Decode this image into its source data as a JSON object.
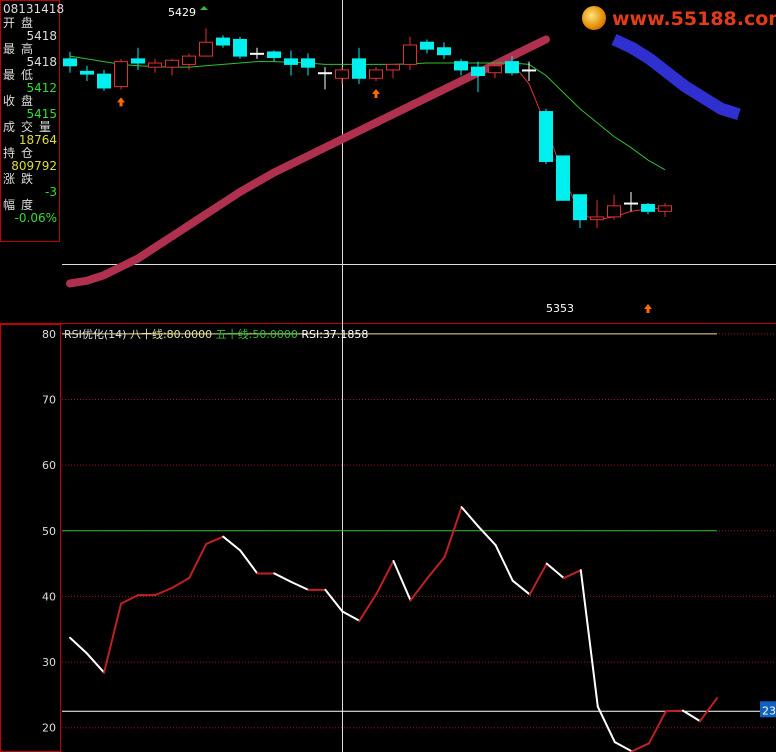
{
  "info_panel": {
    "time": "08131418",
    "rows": [
      {
        "label": "开盘",
        "value": "5418",
        "label_color": "#dddddd",
        "value_color": "#dddddd"
      },
      {
        "label": "最高",
        "value": "5418",
        "label_color": "#dddddd",
        "value_color": "#dddddd"
      },
      {
        "label": "最低",
        "value": "5412",
        "label_color": "#dddddd",
        "value_color": "#33dd33"
      },
      {
        "label": "收盘",
        "value": "5415",
        "label_color": "#dddddd",
        "value_color": "#33dd33"
      },
      {
        "label": "成交量",
        "value": "18764",
        "label_color": "#dddddd",
        "value_color": "#dddd33"
      },
      {
        "label": "持仓",
        "value": "809792",
        "label_color": "#dddddd",
        "value_color": "#dddd33"
      },
      {
        "label": "涨跌",
        "value": "-3",
        "label_color": "#dddddd",
        "value_color": "#33dd33"
      },
      {
        "label": "幅度",
        "value": "-0.06%",
        "label_color": "#dddddd",
        "value_color": "#33dd33"
      }
    ]
  },
  "watermark": {
    "text": "www.55188.com"
  },
  "colors": {
    "up": "#e03030",
    "down": "#00f0f0",
    "ma_green": "#30c030",
    "ma_red": "#e03030",
    "band_red": "#b03050",
    "band_blue": "#3030d0",
    "rsi_up": "#c02020",
    "rsi_down": "#ffffff",
    "line80": "#e0e0a0",
    "line50": "#30c030",
    "grid": "#a01818",
    "crosshair": "#dddddd"
  },
  "chart_data": [
    {
      "type": "candlestick",
      "annotations": [
        {
          "text": "5429",
          "kind": "high"
        },
        {
          "text": "5353",
          "kind": "low"
        }
      ],
      "candles": [
        {
          "o": 5414,
          "h": 5416.5,
          "l": 5409,
          "c": 5411.5
        },
        {
          "o": 5409.5,
          "h": 5411.5,
          "l": 5406,
          "c": 5408.5
        },
        {
          "o": 5408.5,
          "h": 5410,
          "l": 5402.5,
          "c": 5403.5
        },
        {
          "o": 5404,
          "h": 5414,
          "l": 5403,
          "c": 5413
        },
        {
          "o": 5414,
          "h": 5418,
          "l": 5410,
          "c": 5412.5
        },
        {
          "o": 5411,
          "h": 5414,
          "l": 5409,
          "c": 5412.5
        },
        {
          "o": 5411,
          "h": 5414,
          "l": 5408,
          "c": 5413.5
        },
        {
          "o": 5412,
          "h": 5416,
          "l": 5410,
          "c": 5415
        },
        {
          "o": 5415,
          "h": 5425,
          "l": 5415,
          "c": 5420
        },
        {
          "o": 5421.5,
          "h": 5422.5,
          "l": 5418,
          "c": 5419
        },
        {
          "o": 5421,
          "h": 5422,
          "l": 5414,
          "c": 5415
        },
        {
          "o": 5416,
          "h": 5418,
          "l": 5414,
          "c": 5416
        },
        {
          "o": 5416.5,
          "h": 5417,
          "l": 5413,
          "c": 5414.5
        },
        {
          "o": 5414,
          "h": 5417,
          "l": 5408,
          "c": 5412
        },
        {
          "o": 5414,
          "h": 5416,
          "l": 5408,
          "c": 5411
        },
        {
          "o": 5409,
          "h": 5411,
          "l": 5403,
          "c": 5409
        },
        {
          "o": 5407,
          "h": 5411,
          "l": 5405,
          "c": 5410
        },
        {
          "o": 5414,
          "h": 5418,
          "l": 5405,
          "c": 5407
        },
        {
          "o": 5407,
          "h": 5411,
          "l": 5406,
          "c": 5410
        },
        {
          "o": 5410,
          "h": 5412,
          "l": 5407,
          "c": 5412
        },
        {
          "o": 5412,
          "h": 5422,
          "l": 5410,
          "c": 5419
        },
        {
          "o": 5420,
          "h": 5421,
          "l": 5416,
          "c": 5417.5
        },
        {
          "o": 5418,
          "h": 5420,
          "l": 5414,
          "c": 5415.5
        },
        {
          "o": 5413,
          "h": 5414,
          "l": 5408,
          "c": 5410
        },
        {
          "o": 5411,
          "h": 5413,
          "l": 5402,
          "c": 5408
        },
        {
          "o": 5409,
          "h": 5413,
          "l": 5407,
          "c": 5411.5
        },
        {
          "o": 5413,
          "h": 5415,
          "l": 5408,
          "c": 5409
        },
        {
          "o": 5410,
          "h": 5413,
          "l": 5406,
          "c": 5410
        },
        {
          "o": 5395,
          "h": 5396,
          "l": 5376,
          "c": 5377
        },
        {
          "o": 5379,
          "h": 5379,
          "l": 5363,
          "c": 5363
        },
        {
          "o": 5365,
          "h": 5365,
          "l": 5353,
          "c": 5356
        },
        {
          "o": 5356,
          "h": 5363,
          "l": 5353,
          "c": 5357
        },
        {
          "o": 5357,
          "h": 5365,
          "l": 5356,
          "c": 5361
        },
        {
          "o": 5362,
          "h": 5366,
          "l": 5359,
          "c": 5362
        },
        {
          "o": 5361.5,
          "h": 5362,
          "l": 5358,
          "c": 5359
        },
        {
          "o": 5359,
          "h": 5362,
          "l": 5357,
          "c": 5361
        }
      ],
      "ma_green": [
        5415,
        5414,
        5413,
        5412,
        5411.5,
        5411.2,
        5411,
        5411,
        5411.5,
        5412,
        5412.5,
        5413,
        5413,
        5412.8,
        5412.5,
        5412,
        5412,
        5412,
        5412,
        5412,
        5412.2,
        5412.5,
        5412.5,
        5412.5,
        5412.5,
        5412.5,
        5412.5,
        5412,
        5408,
        5402,
        5396,
        5391,
        5386,
        5382,
        5377.5,
        5374
      ],
      "ma_red_from_index": 26,
      "ma_red": [
        5412.5,
        5405,
        5390,
        5372,
        5358,
        5356,
        5357,
        5359,
        5360,
        5360
      ],
      "band_red": [
        5333,
        5334,
        5336,
        5339,
        5342,
        5346,
        5350,
        5354,
        5358,
        5362,
        5366,
        5369.5,
        5373,
        5376,
        5379,
        5382,
        5385,
        5388,
        5391,
        5394,
        5397,
        5400,
        5403,
        5406,
        5409,
        5412,
        5415,
        5418,
        5421
      ],
      "band_blue": [
        5421,
        5418,
        5414,
        5409,
        5404,
        5400,
        5396,
        5394
      ]
    },
    {
      "type": "line",
      "title": "RSI优化(14)",
      "legend": [
        {
          "text": "八十线:80.0000",
          "color": "#e0e0a0"
        },
        {
          "text": "五十线:50.0000",
          "color": "#30c030"
        },
        {
          "text": "RSI:37.1858",
          "color": "#ffffff"
        }
      ],
      "ylim": [
        16.3,
        81.5
      ],
      "yticks": [
        20,
        30,
        40,
        50,
        60,
        70,
        80
      ],
      "reference_lines": [
        80,
        50
      ],
      "current_marker": {
        "value": 22.5,
        "label": "23"
      },
      "values": [
        33.7,
        31.3,
        28.4,
        38.9,
        40.2,
        40.2,
        41.3,
        42.8,
        48.0,
        49.1,
        47.0,
        43.5,
        43.5,
        42.2,
        41.0,
        41.0,
        37.7,
        36.3,
        40.4,
        45.4,
        39.4,
        42.8,
        46.0,
        53.6,
        50.6,
        47.8,
        42.4,
        40.3,
        45.0,
        42.8,
        44.0,
        23.2,
        17.8,
        16.4,
        17.6,
        22.5,
        22.6,
        21.0,
        24.5
      ]
    }
  ]
}
